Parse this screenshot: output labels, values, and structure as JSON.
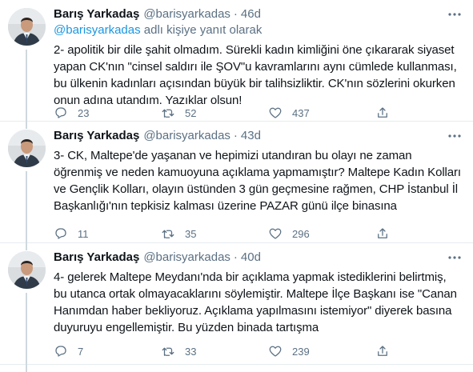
{
  "tweets": [
    {
      "name": "Barış Yarkadaş",
      "handle": "@barisyarkadas",
      "separator": "·",
      "time": "46d",
      "reply_prefix": "@barisyarkadas",
      "reply_suffix": " adlı kişiye yanıt olarak",
      "text": "2- apolitik bir dile şahit olmadım. Sürekli kadın kimliğini öne çıkararak siyaset\nyapan CK'nın \"cinsel saldırı ile ŞOV\"u kavramlarını aynı cümlede kullanması,\nbu ülkenin kadınları açısından büyük bir talihsizliktir. CK'nın sözlerini okurken\nonun adına utandım. Yazıklar olsun!",
      "replies": "23",
      "retweets": "52",
      "likes": "437"
    },
    {
      "name": "Barış Yarkadaş",
      "handle": "@barisyarkadas",
      "separator": "·",
      "time": "43d",
      "text": "3- CK, Maltepe'de yaşanan ve hepimizi utandıran bu olayı ne zaman\nöğrenmiş ve neden kamuoyuna açıklama yapmamıştır? Maltepe Kadın Kolları\nve Gençlik Kolları, olayın üstünden 3 gün geçmesine rağmen, CHP İstanbul İl\nBaşkanlığı'nın tepkisiz  kalması üzerine PAZAR günü ilçe binasına",
      "replies": "11",
      "retweets": "35",
      "likes": "296"
    },
    {
      "name": "Barış Yarkadaş",
      "handle": "@barisyarkadas",
      "separator": "·",
      "time": "40d",
      "text": "4- gelerek Maltepe Meydanı'nda bir açıklama yapmak istediklerini belirtmiş,\nbu utanca ortak olmayacaklarını söylemiştir. Maltepe İlçe Başkanı ise \"Canan\nHanımdan haber bekliyoruz. Açıklama yapılmasını istemiyor\" diyerek basına\nduyuruyu engellemiştir. Bu yüzden binada tartışma",
      "replies": "7",
      "retweets": "33",
      "likes": "239"
    }
  ],
  "colors": {
    "text": "#0f1419",
    "muted": "#5b7083",
    "link": "#1b95e0",
    "border": "#e6ecf0"
  },
  "icons": {
    "reply": "reply-icon",
    "retweet": "retweet-icon",
    "like": "heart-icon",
    "share": "share-icon",
    "more": "more-icon"
  }
}
